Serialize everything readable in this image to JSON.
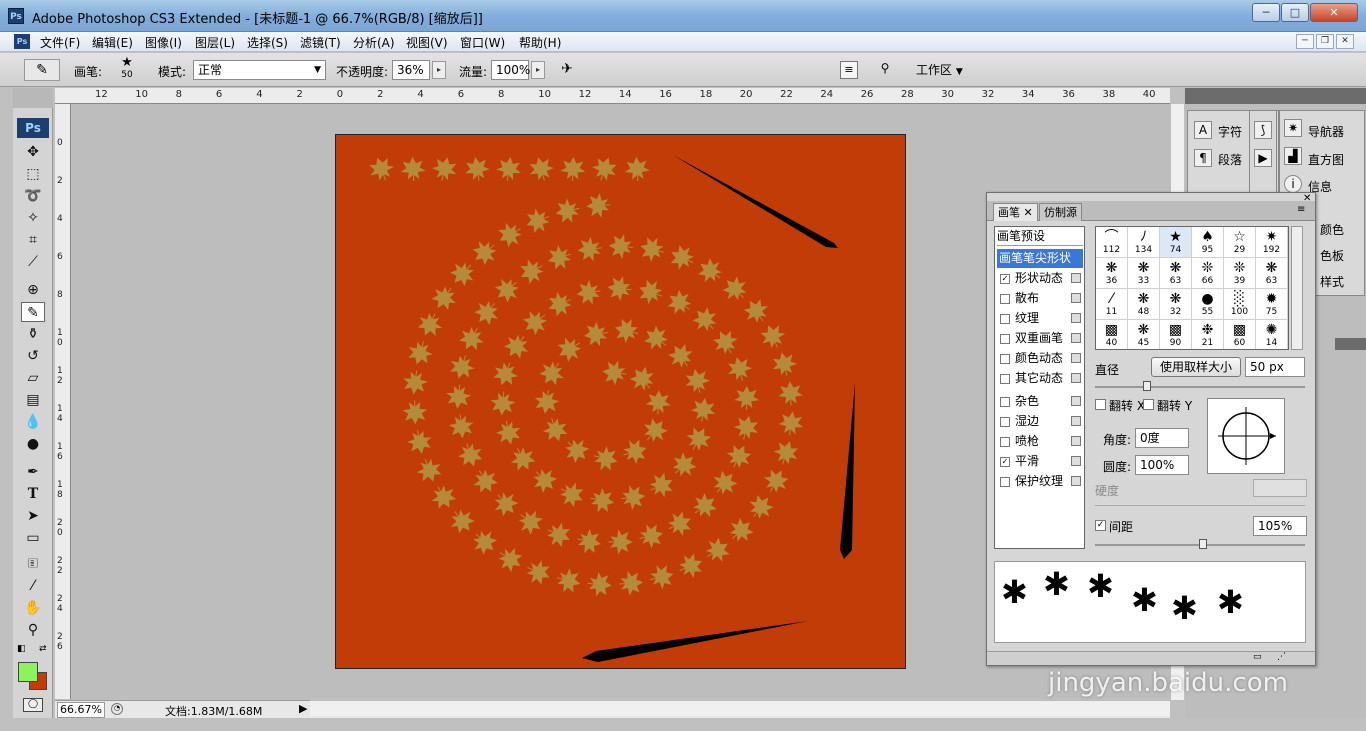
{
  "window": {
    "title": "Adobe Photoshop CS3 Extended - [未标题-1 @ 66.7%(RGB/8) [缩放后]]",
    "min": "─",
    "max": "□",
    "close": "✕",
    "ps_badge": "Ps"
  },
  "menu": [
    "文件(F)",
    "编辑(E)",
    "图像(I)",
    "图层(L)",
    "选择(S)",
    "滤镜(T)",
    "分析(A)",
    "视图(V)",
    "窗口(W)",
    "帮助(H)"
  ],
  "mdi": {
    "min": "─",
    "restore": "❐",
    "close": "✕"
  },
  "options": {
    "brush_label": "画笔:",
    "brush_size": "50",
    "mode_label": "模式:",
    "mode_value": "正常",
    "opacity_label": "不透明度:",
    "opacity_value": "36%",
    "flow_label": "流量:",
    "flow_value": "100%",
    "workspace_label": "工作区"
  },
  "rulers": {
    "h": [
      "12",
      "10",
      "8",
      "6",
      "4",
      "2",
      "0",
      "2",
      "4",
      "6",
      "8",
      "10",
      "12",
      "14",
      "16",
      "18",
      "20",
      "22",
      "24",
      "26",
      "28",
      "30",
      "32",
      "34",
      "36",
      "38",
      "40"
    ],
    "v": [
      "0",
      "2",
      "4",
      "6",
      "8",
      "1 0",
      "1 2",
      "1 4",
      "1 6",
      "1 8",
      "2 0",
      "2 2",
      "2 4",
      "2 6"
    ]
  },
  "status": {
    "zoom": "66.67%",
    "doc": "文档:1.83M/1.68M"
  },
  "side_panels": {
    "char": "字符",
    "para": "段落",
    "navigator": "导航器",
    "histogram": "直方图",
    "info": "信息",
    "color": "颜色",
    "swatches": "色板",
    "styles": "样式"
  },
  "brush_panel": {
    "tab_brush": "画笔",
    "tab_clone": "仿制源",
    "presets": "画笔预设",
    "items": [
      {
        "label": "画笔笔尖形状",
        "checked": null
      },
      {
        "label": "形状动态",
        "checked": true
      },
      {
        "label": "散布",
        "checked": false
      },
      {
        "label": "纹理",
        "checked": false
      },
      {
        "label": "双重画笔",
        "checked": false
      },
      {
        "label": "颜色动态",
        "checked": false
      },
      {
        "label": "其它动态",
        "checked": false
      },
      {
        "label": "杂色",
        "checked": false
      },
      {
        "label": "湿边",
        "checked": false
      },
      {
        "label": "喷枪",
        "checked": false
      },
      {
        "label": "平滑",
        "checked": true
      },
      {
        "label": "保护纹理",
        "checked": false
      }
    ],
    "tips": [
      "112",
      "134",
      "74",
      "95",
      "29",
      "192",
      "36",
      "33",
      "63",
      "66",
      "39",
      "63",
      "11",
      "48",
      "32",
      "55",
      "100",
      "75",
      "40",
      "45",
      "90",
      "21",
      "60",
      "14"
    ],
    "diameter_label": "直径",
    "sample_size_btn": "使用取样大小",
    "diameter_value": "50 px",
    "flip_x": "翻转 X",
    "flip_y": "翻转 Y",
    "angle_label": "角度:",
    "angle_value": "0度",
    "roundness_label": "圆度:",
    "roundness_value": "100%",
    "hardness_label": "硬度",
    "spacing_label": "间距",
    "spacing_value": "105%"
  },
  "canvas_color": "#c23c08",
  "leaf_color": "#b58a3b",
  "fg_color": "#8ef25c",
  "bg_color": "#c23c08",
  "watermark": "jingyan.baidu.com"
}
